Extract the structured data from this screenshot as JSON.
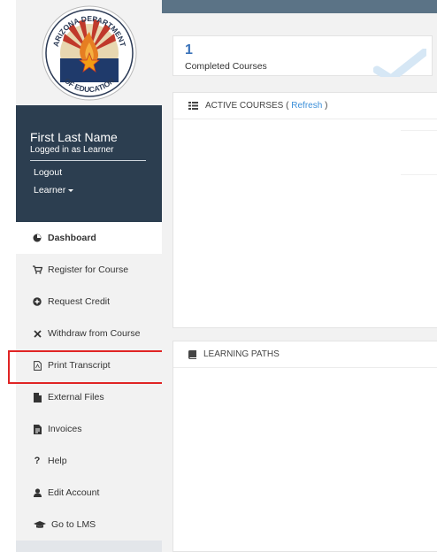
{
  "sidebar": {
    "logo": {
      "top_text": "ARIZONA DEPARTMENT",
      "bottom_text": "OF EDUCATION"
    },
    "user": {
      "name": "First Last Name",
      "role_text": "Logged in as Learner",
      "logout_label": "Logout",
      "role_menu_label": "Learner"
    },
    "nav": [
      {
        "label": "Dashboard",
        "icon": "dashboard-icon",
        "active": true
      },
      {
        "label": "Register for Course",
        "icon": "cart-icon"
      },
      {
        "label": "Request Credit",
        "icon": "plus-circle-icon"
      },
      {
        "label": "Withdraw from Course",
        "icon": "x-icon"
      },
      {
        "label": "Print Transcript",
        "icon": "pdf-file-icon"
      },
      {
        "label": "External Files",
        "icon": "file-icon"
      },
      {
        "label": "Invoices",
        "icon": "invoice-icon"
      },
      {
        "label": "Help",
        "icon": "question-icon"
      },
      {
        "label": "Edit Account",
        "icon": "user-icon"
      },
      {
        "label": "Go to LMS",
        "icon": "graduation-cap-icon"
      }
    ]
  },
  "main": {
    "completed": {
      "count": "1",
      "label": "Completed Courses"
    },
    "active_courses": {
      "title": "ACTIVE COURSES",
      "paren_open": "(",
      "refresh_label": "Refresh",
      "paren_close": ")"
    },
    "learning_paths": {
      "title": "LEARNING PATHS"
    }
  },
  "colors": {
    "sidebar_bg": "#f2f2f2",
    "user_panel_bg": "#2c3e50",
    "topbar": "#5b7386",
    "accent": "#3b73b9",
    "link": "#3b8fd9",
    "highlight": "#e02424"
  }
}
